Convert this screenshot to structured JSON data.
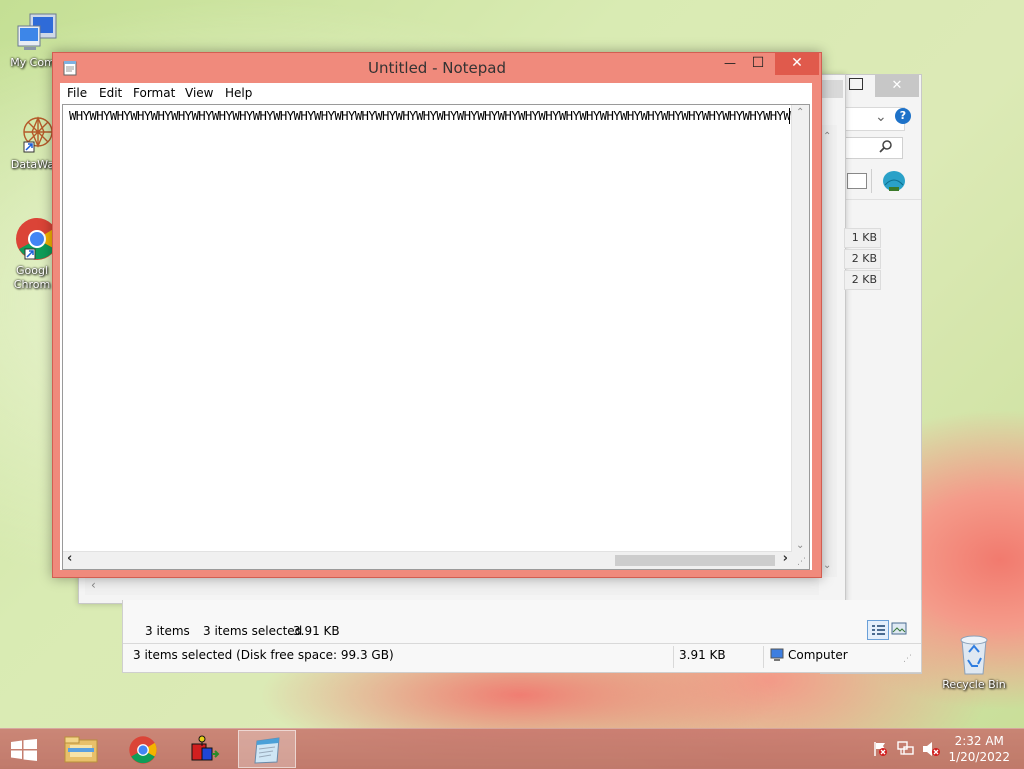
{
  "desktop": {
    "icons": [
      {
        "label": "My Comp",
        "icon": "computer-icon"
      },
      {
        "label": "DataWag",
        "icon": "datawag-icon"
      },
      {
        "label": "Googl Chrom",
        "icon": "chrome-icon"
      },
      {
        "label": "Recycle Bin",
        "icon": "recycle-bin-icon"
      }
    ]
  },
  "explorer": {
    "file_sizes": [
      "1 KB",
      "2 KB",
      "2 KB"
    ],
    "status": {
      "items_count": "3 items",
      "selected": "3 items selected",
      "selected_size": "3.91 KB",
      "bottom_text": "3 items selected (Disk free space: 99.3 GB)",
      "bottom_size": "3.91 KB",
      "location": "Computer"
    },
    "controls": {
      "close": "✕",
      "help": "?"
    }
  },
  "notepad": {
    "title": "Untitled - Notepad",
    "controls": {
      "minimize": "—",
      "maximize": "☐",
      "close": "✕"
    },
    "menu": [
      "File",
      "Edit",
      "Format",
      "View",
      "Help"
    ],
    "content": "WHYWHYWHYWHYWHYWHYWHYWHYWHYWHYWHYWHYWHYWHYWHYWHYWHYWHYWHYWHYWHYWHYWHYWHYWHYWHYWHYWHYWHYWHYWHYWHYWHYWHYWHYWHY",
    "scroll": {
      "left": "<",
      "right": ">",
      "up": "^",
      "down": "v"
    }
  },
  "taskbar": {
    "buttons": [
      {
        "icon": "start-windows-icon"
      },
      {
        "icon": "file-explorer-icon"
      },
      {
        "icon": "chrome-icon"
      },
      {
        "icon": "app-cube-icon"
      },
      {
        "icon": "notepad-icon",
        "active": true
      }
    ],
    "tray": [
      "flag-icon",
      "network-icon",
      "volume-muted-icon"
    ],
    "time": "2:32 AM",
    "date": "1/20/2022"
  }
}
